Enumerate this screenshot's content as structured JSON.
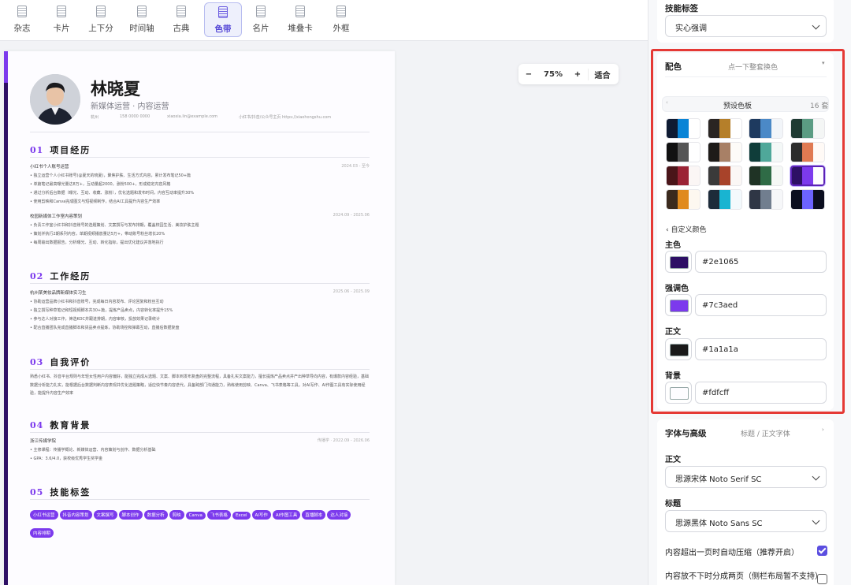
{
  "toolbar": {
    "templates": [
      "杂志",
      "卡片",
      "上下分",
      "时间轴",
      "古典",
      "色带",
      "名片",
      "堆叠卡",
      "外框"
    ],
    "active_template": "色带"
  },
  "zoom": {
    "minus": "−",
    "level": "75%",
    "plus": "+",
    "fit": "适合"
  },
  "resume": {
    "name": "林晓夏",
    "title": "新媒体运营 · 内容运营",
    "contact": [
      "杭州",
      "158 0000 0000",
      "xiaoxia.lin@example.com",
      "小红书/抖音/公众号主页 https://xiaohongshu.com"
    ],
    "sections": [
      {
        "no": "01",
        "label": "项目经历"
      },
      {
        "no": "02",
        "label": "工作经历"
      },
      {
        "no": "03",
        "label": "自我评价"
      },
      {
        "no": "04",
        "label": "教育背景"
      },
      {
        "no": "05",
        "label": "技能标签"
      }
    ],
    "projects": [
      {
        "title": "小红书个人账号运营",
        "date": "2024.03 - 至今",
        "bullets": [
          "独立运营个人小红书账号(@夏天的晓夏)，聚焦护肤、生活方式内容，累计发布笔记50+篇",
          "单篇笔记最高曝光量达8万+，互动量超2000，涨粉500+，形成稳定内容风格",
          "通过分析后台数据（曝光、互动、收藏、涨粉），优化选题和发布时间，内容互动率提升30%",
          "使用剪映和Canva完成图文与短视频制作，结合AI工具提升内容生产效率"
        ]
      },
      {
        "title": "校园新媒体工作室内容策划",
        "date": "2024.09 - 2025.06",
        "bullets": [
          "负责工作室小红书和抖音账号的选题策划、文案撰写与发布排期，覆盖校园生活、美妆护肤主题",
          "策划并执行2期系列内容，单期视频播放量达5万+，带动账号粉丝增长20%",
          "每周输出数据报告，分析曝光、互动、转化指标，提出优化建议并落地执行"
        ]
      }
    ],
    "work": {
      "title": "杭州某美妆品牌新媒体实习生",
      "date": "2025.06 - 2025.09",
      "bullets": [
        "协助运营品牌小红书和抖音账号，完成每日内容发布、评论回复和粉丝互动",
        "独立撰写种草笔记和短视频脚本共30+篇，提炼产品卖点，内容转化率提升15%",
        "参与达人对接工作，筛选KOC并跟进排期，内容审核，投放效果记录统计",
        "配合直播团队完成直播脚本和货品卖点提炼，协助场控和弹幕互动，直播后数据复盘"
      ]
    },
    "summary": "熟悉小红书、抖音平台规则与年轻女性用户内容偏好，能独立完成从选题、文案、脚本到发布复盘的完整流程，具备扎实文案能力，擅长提炼产品卖点并产出种草导向内容，有爆款内容经验，基础数据分析能力扎实，能根据后台数据判断内容表现并优化选题策略，适应快节奏内容迭代，具备跨部门沟通能力，熟练使用剪映、Canva、飞书表格等工具，对AI写作、AI作图工具有实际使用经验，能提升内容生产效率",
    "education": {
      "title": "浙江传媒学院",
      "date": "传播学 · 2022.09 - 2026.06",
      "bullets": [
        "主修课程：传播学概论、新媒体运营、内容策划与创作、数据分析基础",
        "GPA：3.6/4.0，获校级优秀学生奖学金"
      ]
    },
    "tags": [
      "小红书运营",
      "抖音内容策划",
      "文案撰写",
      "脚本创作",
      "数据分析",
      "剪映",
      "Canva",
      "飞书表格",
      "Excel",
      "AI写作",
      "AI作图工具",
      "直播脚本",
      "达人对接",
      "内容排期"
    ]
  },
  "panel": {
    "skill_tags": {
      "title": "技能标签",
      "style": "实心强调"
    },
    "color": {
      "title": "配色",
      "hint": "点一下整套换色",
      "preset_label": "预设色板",
      "preset_count": "16 套",
      "custom_label": "自定义颜色",
      "presets": [
        [
          "#0f1b33",
          "#0a84d6",
          "#ffffff"
        ],
        [
          "#2a2522",
          "#b57f2a",
          "#ffffff"
        ],
        [
          "#1e3a5f",
          "#4b89c7",
          "#f2f5f9"
        ],
        [
          "#1f3b33",
          "#5b9c83",
          "#f4f6f5"
        ],
        [
          "#111111",
          "#555555",
          "#ffffff"
        ],
        [
          "#1e1b18",
          "#a88066",
          "#fdfbf8"
        ],
        [
          "#0f3d3a",
          "#4fa89a",
          "#f4f8f7"
        ],
        [
          "#2c2c2c",
          "#e07a52",
          "#fffaf6"
        ],
        [
          "#4a1519",
          "#9b2335",
          "#fbf6f5"
        ],
        [
          "#3a3a3a",
          "#a8432a",
          "#fbf7f5"
        ],
        [
          "#1f3325",
          "#2f6b46",
          "#f5f8f5"
        ],
        [
          "#2e1065",
          "#7c3aed",
          "#fdfcff"
        ],
        [
          "#3b2a1d",
          "#e08a1e",
          "#fdf8f0"
        ],
        [
          "#1d2b3a",
          "#19b4d1",
          "#f3f9fc"
        ],
        [
          "#2f3645",
          "#717e8f",
          "#f6f7f9"
        ],
        [
          "#0b0e1f",
          "#6c63ff",
          "#0b0e1f"
        ]
      ],
      "selected_preset": 11,
      "fields": [
        {
          "label": "主色",
          "value": "#2e1065"
        },
        {
          "label": "强调色",
          "value": "#7c3aed"
        },
        {
          "label": "正文",
          "value": "#1a1a1a"
        },
        {
          "label": "背景",
          "value": "#fdfcff"
        }
      ]
    },
    "font": {
      "title": "字体与高级",
      "hint": "标题 / 正文字体",
      "body_label": "正文",
      "body_value": "思源宋体 Noto Serif SC",
      "heading_label": "标题",
      "heading_value": "思源黑体 Noto Sans SC",
      "auto_shrink": "内容超出一页时自动压缩（推荐开启）",
      "auto_shrink_on": true,
      "split_label": "内容放不下时分成两页（侧栏布局暂不支持）",
      "split_on": false
    }
  }
}
